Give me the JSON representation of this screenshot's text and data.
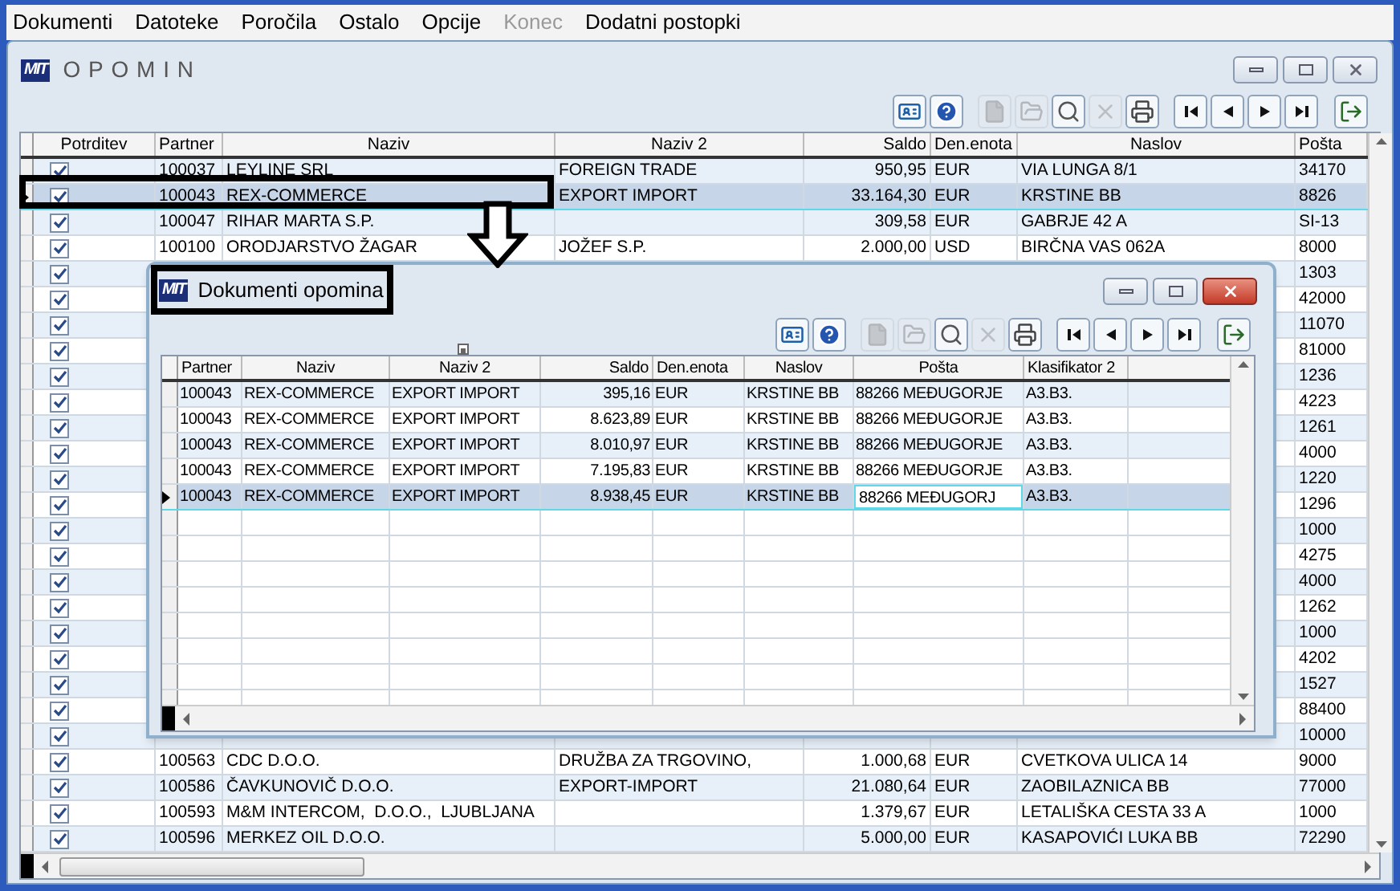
{
  "menu": [
    {
      "label": "Dokumenti",
      "disabled": false
    },
    {
      "label": "Datoteke",
      "disabled": false
    },
    {
      "label": "Poročila",
      "disabled": false
    },
    {
      "label": "Ostalo",
      "disabled": false
    },
    {
      "label": "Opcije",
      "disabled": false
    },
    {
      "label": "Konec",
      "disabled": true
    },
    {
      "label": "Dodatni postopki",
      "disabled": false
    }
  ],
  "window": {
    "logo": "MIT",
    "title": "OPOMIN"
  },
  "toolbar": [
    {
      "kind": "card",
      "disabled": false
    },
    {
      "kind": "help",
      "disabled": false
    },
    {
      "kind": "new",
      "disabled": true
    },
    {
      "kind": "open",
      "disabled": true
    },
    {
      "kind": "find",
      "disabled": false
    },
    {
      "kind": "delete",
      "disabled": true
    },
    {
      "kind": "print",
      "disabled": false
    },
    {
      "kind": "first",
      "disabled": false
    },
    {
      "kind": "prev",
      "disabled": false
    },
    {
      "kind": "next",
      "disabled": false
    },
    {
      "kind": "last",
      "disabled": false
    },
    {
      "kind": "exit",
      "disabled": false
    }
  ],
  "table": {
    "columns": [
      "Potrditev",
      "Partner",
      "Naziv",
      "Naziv 2",
      "Saldo",
      "Den.enota",
      "Naslov",
      "Pošta"
    ],
    "rows": [
      {
        "selected": false,
        "checked": true,
        "partner": "100037",
        "naziv": "LEYLINE SRL",
        "naziv_2": "FOREIGN TRADE",
        "saldo": "950,95",
        "den_enota": "EUR",
        "naslov": "VIA LUNGA 8/1",
        "posta": "34170"
      },
      {
        "selected": true,
        "checked": true,
        "partner": "100043",
        "naziv": "REX-COMMERCE",
        "naziv_2": "EXPORT IMPORT",
        "saldo": "33.164,30",
        "den_enota": "EUR",
        "naslov": "KRSTINE BB",
        "posta": "8826"
      },
      {
        "selected": false,
        "checked": true,
        "partner": "100047",
        "naziv": "RIHAR MARTA S.P.",
        "saldo": "309,58",
        "den_enota": "EUR",
        "naslov": "GABRJE 42 A",
        "posta": "SI-13"
      },
      {
        "selected": false,
        "checked": true,
        "partner": "100100",
        "naziv": "ORODJARSTVO ŽAGAR",
        "naziv_2": "JOŽEF S.P.",
        "saldo": "2.000,00",
        "den_enota": "USD",
        "naslov": "BIRČNA VAS 062A",
        "posta": "8000"
      },
      {
        "selected": false,
        "checked": true,
        "posta": "1303"
      },
      {
        "selected": false,
        "checked": true,
        "posta": "42000"
      },
      {
        "selected": false,
        "checked": true,
        "posta": "11070"
      },
      {
        "selected": false,
        "checked": true,
        "posta": "81000"
      },
      {
        "selected": false,
        "checked": true,
        "posta": "1236"
      },
      {
        "selected": false,
        "checked": true,
        "posta": "4223"
      },
      {
        "selected": false,
        "checked": true,
        "posta": "1261"
      },
      {
        "selected": false,
        "checked": true,
        "posta": "4000"
      },
      {
        "selected": false,
        "checked": true,
        "posta": "1220"
      },
      {
        "selected": false,
        "checked": true,
        "posta": "1296"
      },
      {
        "selected": false,
        "checked": true,
        "posta": "1000"
      },
      {
        "selected": false,
        "checked": true,
        "posta": "4275"
      },
      {
        "selected": false,
        "checked": true,
        "posta": "4000"
      },
      {
        "selected": false,
        "checked": true,
        "posta": "1262"
      },
      {
        "selected": false,
        "checked": true,
        "posta": "1000"
      },
      {
        "selected": false,
        "checked": true,
        "posta": "4202"
      },
      {
        "selected": false,
        "checked": true,
        "posta": "1527"
      },
      {
        "selected": false,
        "checked": true,
        "posta": "88400"
      },
      {
        "selected": false,
        "checked": true,
        "posta": "10000"
      },
      {
        "selected": false,
        "checked": true,
        "partner": "100563",
        "naziv": "CDC D.O.O.",
        "naziv_2": "DRUŽBA ZA TRGOVINO,",
        "saldo": "1.000,68",
        "den_enota": "EUR",
        "naslov": "CVETKOVA ULICA 14",
        "posta": "9000"
      },
      {
        "selected": false,
        "checked": true,
        "partner": "100586",
        "naziv": "ČAVKUNOVIČ D.O.O.",
        "naziv_2": "EXPORT-IMPORT",
        "saldo": "21.080,64",
        "den_enota": "EUR",
        "naslov": "ZAOBILAZNICA BB",
        "posta": "77000"
      },
      {
        "selected": false,
        "checked": true,
        "partner": "100593",
        "naziv": "M&M INTERCOM,  D.O.O.,  LJUBLJANA",
        "saldo": "1.379,67",
        "den_enota": "EUR",
        "naslov": "LETALIŠKA CESTA 33 A",
        "posta": "1000"
      },
      {
        "selected": false,
        "checked": true,
        "partner": "100596",
        "naziv": "MERKEZ OIL D.O.O.",
        "saldo": "5.000,00",
        "den_enota": "EUR",
        "naslov": "KASAPOVIĆI LUKA BB",
        "posta": "72290"
      }
    ]
  },
  "dialog": {
    "logo": "MIT",
    "title": "Dokumenti opomina",
    "toolbar": [
      {
        "kind": "card",
        "disabled": false
      },
      {
        "kind": "help",
        "disabled": false
      },
      {
        "kind": "new",
        "disabled": true
      },
      {
        "kind": "open",
        "disabled": true
      },
      {
        "kind": "find",
        "disabled": false
      },
      {
        "kind": "delete",
        "disabled": true
      },
      {
        "kind": "print",
        "disabled": false
      },
      {
        "kind": "first",
        "disabled": false
      },
      {
        "kind": "prev",
        "disabled": false
      },
      {
        "kind": "next",
        "disabled": false
      },
      {
        "kind": "last",
        "disabled": false
      },
      {
        "kind": "exit",
        "disabled": false
      }
    ],
    "table": {
      "columns": [
        "Partner",
        "Naziv",
        "Naziv 2",
        "Saldo",
        "Den.enota",
        "Naslov",
        "Pošta",
        "Klasifikator 2"
      ],
      "rows": [
        {
          "selected": false,
          "editing": false,
          "partner": "100043",
          "naziv": "REX-COMMERCE",
          "naziv_2": "EXPORT IMPORT",
          "saldo": "395,16",
          "den_enota": "EUR",
          "naslov": "KRSTINE BB",
          "posta": "88266 MEĐUGORJE",
          "klasifikator_2": "A3.B3."
        },
        {
          "selected": false,
          "editing": false,
          "partner": "100043",
          "naziv": "REX-COMMERCE",
          "naziv_2": "EXPORT IMPORT",
          "saldo": "8.623,89",
          "den_enota": "EUR",
          "naslov": "KRSTINE BB",
          "posta": "88266 MEĐUGORJE",
          "klasifikator_2": "A3.B3."
        },
        {
          "selected": false,
          "editing": false,
          "partner": "100043",
          "naziv": "REX-COMMERCE",
          "naziv_2": "EXPORT IMPORT",
          "saldo": "8.010,97",
          "den_enota": "EUR",
          "naslov": "KRSTINE BB",
          "posta": "88266 MEĐUGORJE",
          "klasifikator_2": "A3.B3."
        },
        {
          "selected": false,
          "editing": false,
          "partner": "100043",
          "naziv": "REX-COMMERCE",
          "naziv_2": "EXPORT IMPORT",
          "saldo": "7.195,83",
          "den_enota": "EUR",
          "naslov": "KRSTINE BB",
          "posta": "88266 MEĐUGORJE",
          "klasifikator_2": "A3.B3."
        },
        {
          "selected": true,
          "editing": true,
          "partner": "100043",
          "naziv": "REX-COMMERCE",
          "naziv_2": "EXPORT IMPORT",
          "saldo": "8.938,45",
          "den_enota": "EUR",
          "naslov": "KRSTINE BB",
          "posta": "88266 MEĐUGORJ",
          "klasifikator_2": "A3.B3."
        }
      ]
    }
  }
}
